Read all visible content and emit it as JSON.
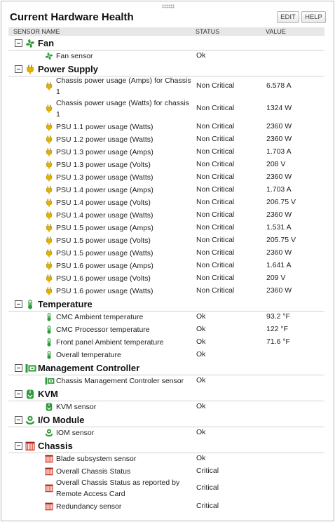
{
  "panel": {
    "title": "Current Hardware Health",
    "edit_label": "EDIT",
    "help_label": "HELP"
  },
  "columns": {
    "name": "SENSOR NAME",
    "status": "STATUS",
    "value": "VALUE"
  },
  "groups": [
    {
      "title": "Fan",
      "icon": "fan-icon",
      "rows": [
        {
          "name": "Fan sensor",
          "status": "Ok",
          "value": ""
        }
      ]
    },
    {
      "title": "Power Supply",
      "icon": "power-plug-icon",
      "rows": [
        {
          "name": "Chassis power usage (Amps) for Chassis 1",
          "status": "Non Critical",
          "value": "6.578 A"
        },
        {
          "name": "Chassis power usage (Watts) for chassis 1",
          "status": "Non Critical",
          "value": "1324 W"
        },
        {
          "name": "PSU 1.1 power usage (Watts)",
          "status": "Non Critical",
          "value": "2360 W"
        },
        {
          "name": "PSU 1.2 power usage (Watts)",
          "status": "Non Critical",
          "value": "2360 W"
        },
        {
          "name": "PSU 1.3 power usage (Amps)",
          "status": "Non Critical",
          "value": "1.703 A"
        },
        {
          "name": "PSU 1.3 power usage (Volts)",
          "status": "Non Critical",
          "value": "208 V"
        },
        {
          "name": "PSU 1.3 power usage (Watts)",
          "status": "Non Critical",
          "value": "2360 W"
        },
        {
          "name": "PSU 1.4 power usage (Amps)",
          "status": "Non Critical",
          "value": "1.703 A"
        },
        {
          "name": "PSU 1.4 power usage (Volts)",
          "status": "Non Critical",
          "value": "206.75 V"
        },
        {
          "name": "PSU 1.4 power usage (Watts)",
          "status": "Non Critical",
          "value": "2360 W"
        },
        {
          "name": "PSU 1.5 power usage (Amps)",
          "status": "Non Critical",
          "value": "1.531 A"
        },
        {
          "name": "PSU 1.5 power usage (Volts)",
          "status": "Non Critical",
          "value": "205.75 V"
        },
        {
          "name": "PSU 1.5 power usage (Watts)",
          "status": "Non Critical",
          "value": "2360 W"
        },
        {
          "name": "PSU 1.6 power usage (Amps)",
          "status": "Non Critical",
          "value": "1.641 A"
        },
        {
          "name": "PSU 1.6 power usage (Volts)",
          "status": "Non Critical",
          "value": "209 V"
        },
        {
          "name": "PSU 1.6 power usage (Watts)",
          "status": "Non Critical",
          "value": "2360 W"
        }
      ]
    },
    {
      "title": "Temperature",
      "icon": "thermometer-icon",
      "rows": [
        {
          "name": "CMC Ambient temperature",
          "status": "Ok",
          "value": "93.2 °F"
        },
        {
          "name": "CMC Processor temperature",
          "status": "Ok",
          "value": "122 °F"
        },
        {
          "name": "Front panel Ambient temperature",
          "status": "Ok",
          "value": "71.6 °F"
        },
        {
          "name": "Overall temperature",
          "status": "Ok",
          "value": ""
        }
      ]
    },
    {
      "title": "Management Controller",
      "icon": "management-controller-icon",
      "rows": [
        {
          "name": "Chassis Management Controler sensor",
          "status": "Ok",
          "value": ""
        }
      ]
    },
    {
      "title": "KVM",
      "icon": "kvm-icon",
      "rows": [
        {
          "name": "KVM sensor",
          "status": "Ok",
          "value": ""
        }
      ]
    },
    {
      "title": "I/O Module",
      "icon": "io-module-icon",
      "rows": [
        {
          "name": "IOM sensor",
          "status": "Ok",
          "value": ""
        }
      ]
    },
    {
      "title": "Chassis",
      "icon": "chassis-icon",
      "rows": [
        {
          "name": "Blade subsystem sensor",
          "status": "Ok",
          "value": ""
        },
        {
          "name": "Overall Chassis Status",
          "status": "Critical",
          "value": ""
        },
        {
          "name": "Overall Chassis Status as reported by Remote Access Card",
          "status": "Critical",
          "value": ""
        },
        {
          "name": "Redundancy sensor",
          "status": "Critical",
          "value": ""
        }
      ]
    }
  ],
  "colors": {
    "fan": "#2e9a3a",
    "power": "#e1b300",
    "temperature": "#2e9a3a",
    "management": "#2e9a3a",
    "kvm": "#2e9a3a",
    "iom": "#2e9a3a",
    "chassis": "#d23b2a",
    "header_bg": "#e7e7e7"
  }
}
